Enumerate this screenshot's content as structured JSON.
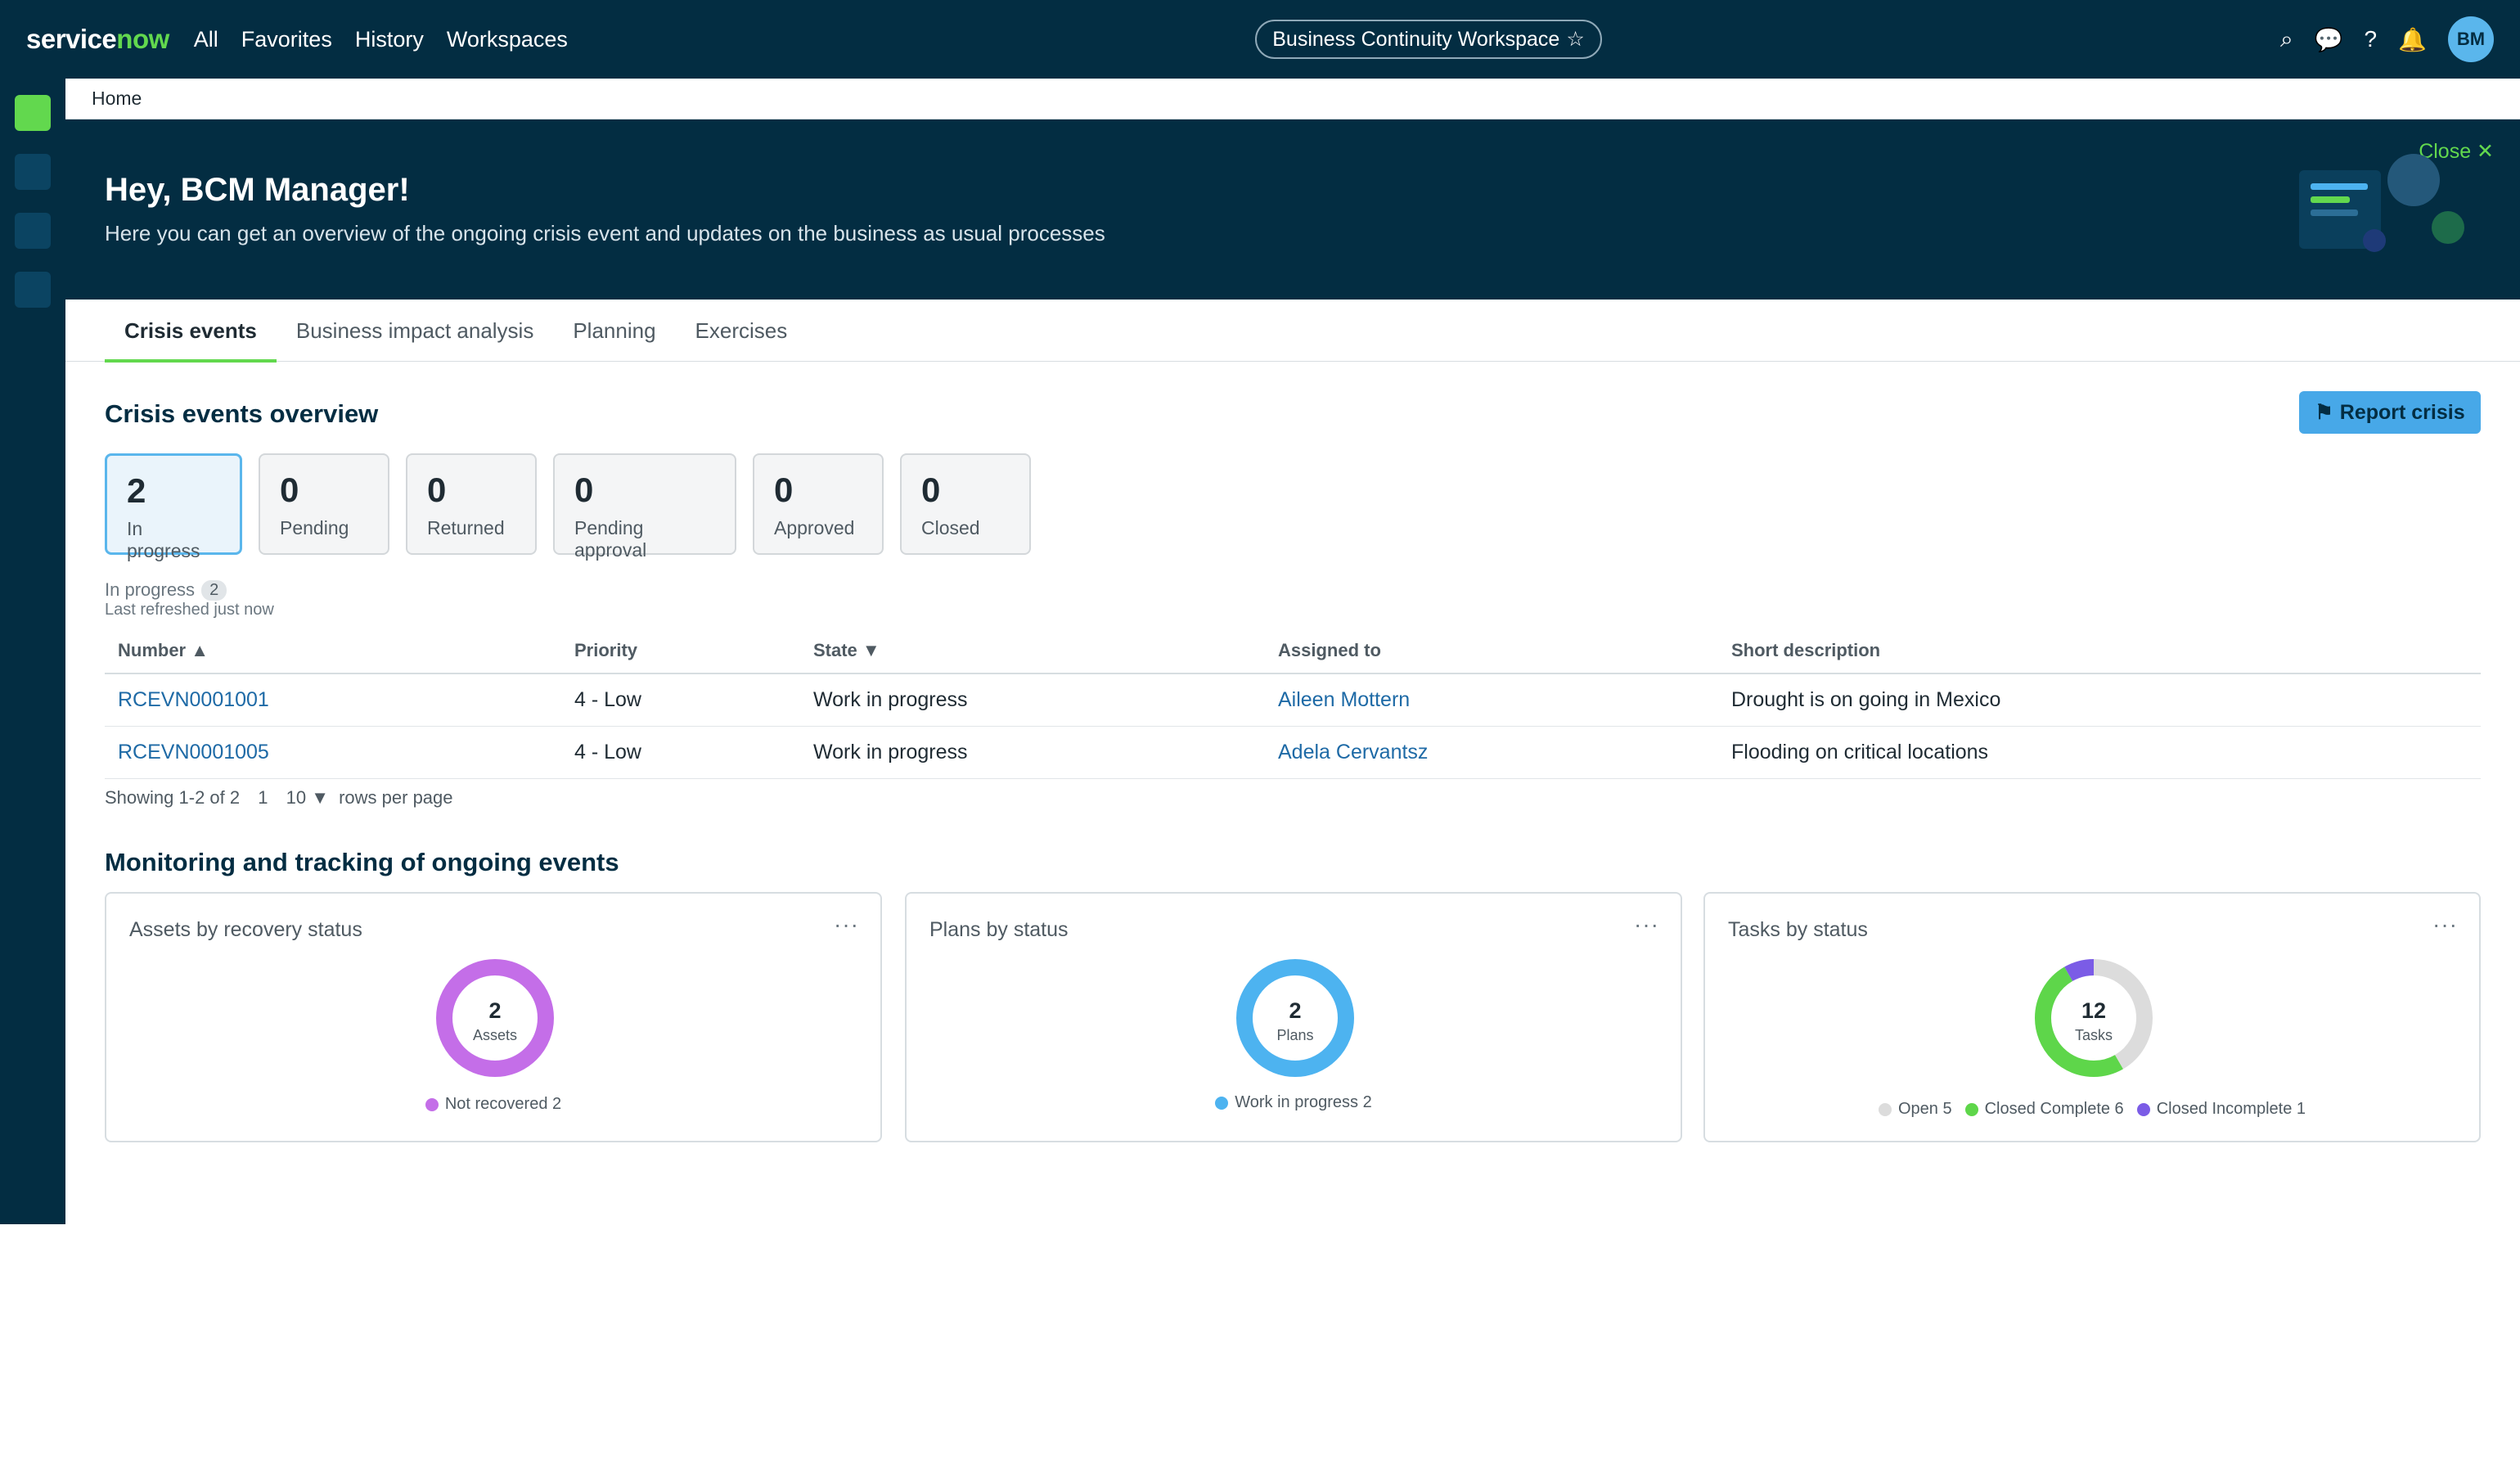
{
  "topbar": {
    "logo_service": "service",
    "logo_now": "now",
    "nav": [
      "All",
      "Favorites",
      "History",
      "Workspaces"
    ],
    "workspace": "Business Continuity Workspace",
    "workspace_star": "☆",
    "avatar": "BM"
  },
  "breadcrumb": "Home",
  "hero": {
    "title": "Hey, BCM Manager!",
    "subtitle": "Here you can get an overview of the ongoing crisis event and updates on the business as usual processes",
    "close_label": "Close ✕"
  },
  "tabs": [
    "Crisis events",
    "Business impact analysis",
    "Planning",
    "Exercises"
  ],
  "overview": {
    "title": "Crisis events overview",
    "report_button": "Report crisis",
    "cards": [
      {
        "count": "2",
        "label": "In progress"
      },
      {
        "count": "0",
        "label": "Pending"
      },
      {
        "count": "0",
        "label": "Returned"
      },
      {
        "count": "0",
        "label": "Pending approval"
      },
      {
        "count": "0",
        "label": "Approved"
      },
      {
        "count": "0",
        "label": "Closed"
      }
    ],
    "filter_label": "In progress",
    "filter_count": "2",
    "refreshed": "Last refreshed just now"
  },
  "table": {
    "headers": [
      "Number ▲",
      "Priority",
      "State ▼",
      "Assigned to",
      "Short description"
    ],
    "rows": [
      [
        "RCEVN0001001",
        "4 - Low",
        "Work in progress",
        "Aileen Mottern",
        "Drought is on going in Mexico"
      ],
      [
        "RCEVN0001005",
        "4 - Low",
        "Work in progress",
        "Adela Cervantsz",
        "Flooding on critical locations"
      ]
    ],
    "pager": {
      "showing": "Showing 1-2 of 2",
      "page": "1",
      "rows_per_page": "10 ▼",
      "rows_label": "rows per page"
    }
  },
  "monitoring": {
    "title": "Monitoring and tracking of ongoing events",
    "menu": "···",
    "widgets": [
      {
        "title": "Assets by recovery status",
        "total": "2",
        "unit": "Assets",
        "segments": [
          {
            "label": "Not recovered 2",
            "value": 2,
            "color": "#c46ee8"
          }
        ]
      },
      {
        "title": "Plans by status",
        "total": "2",
        "unit": "Plans",
        "segments": [
          {
            "label": "Work in progress 2",
            "value": 2,
            "color": "#4db3f0"
          }
        ]
      },
      {
        "title": "Tasks by status",
        "total": "12",
        "unit": "Tasks",
        "segments": [
          {
            "label": "Open 5",
            "value": 5,
            "color": "#dcdcdc"
          },
          {
            "label": "Closed Complete 6",
            "value": 6,
            "color": "#5ed64a"
          },
          {
            "label": "Closed Incomplete 1",
            "value": 1,
            "color": "#7b5ce6"
          }
        ]
      }
    ]
  }
}
